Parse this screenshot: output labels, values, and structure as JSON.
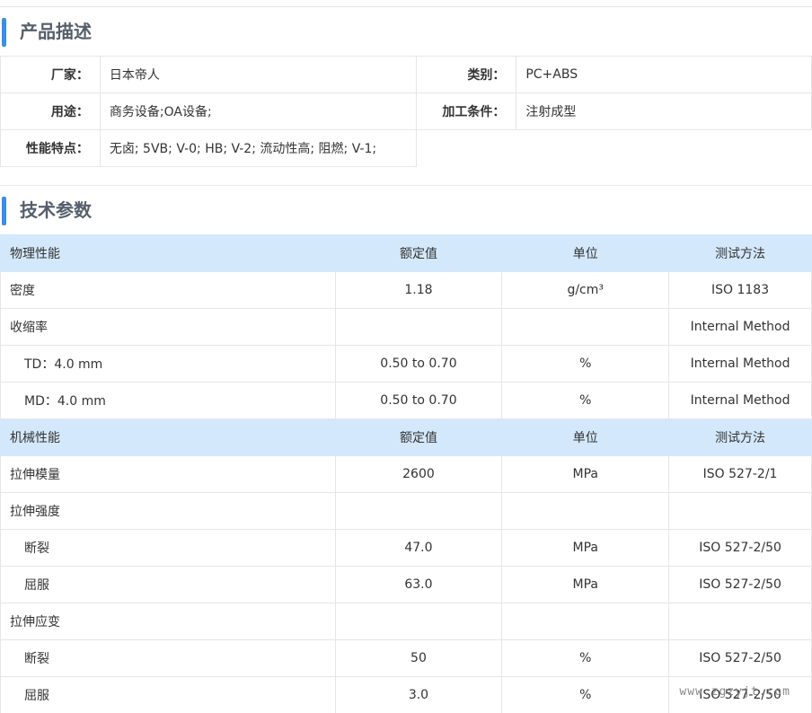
{
  "sections": {
    "description_title": "产品描述",
    "tech_title": "技术参数"
  },
  "info": {
    "manufacturer_label": "厂家：",
    "manufacturer_value": "日本帝人",
    "category_label": "类别：",
    "category_value": "PC+ABS",
    "usage_label": "用途：",
    "usage_value": "商务设备;OA设备;",
    "processing_label": "加工条件：",
    "processing_value": "注射成型",
    "features_label": "性能特点：",
    "features_value": "无卤; 5VB; V-0; HB; V-2; 流动性高; 阻燃; V-1;"
  },
  "tech_rows": [
    {
      "type": "group",
      "name": "物理性能",
      "value": "额定值",
      "unit": "单位",
      "method": "测试方法"
    },
    {
      "type": "row",
      "name": "密度",
      "value": "1.18",
      "unit": "g/cm³",
      "method": "ISO 1183"
    },
    {
      "type": "row",
      "name": "收缩率",
      "value": "",
      "unit": "",
      "method": "Internal Method"
    },
    {
      "type": "sub",
      "name": "TD：4.0 mm",
      "value": "0.50 to 0.70",
      "unit": "%",
      "method": "Internal Method"
    },
    {
      "type": "sub",
      "name": "MD：4.0 mm",
      "value": "0.50 to 0.70",
      "unit": "%",
      "method": "Internal Method"
    },
    {
      "type": "group",
      "name": "机械性能",
      "value": "额定值",
      "unit": "单位",
      "method": "测试方法"
    },
    {
      "type": "row",
      "name": "拉伸模量",
      "value": "2600",
      "unit": "MPa",
      "method": "ISO 527-2/1"
    },
    {
      "type": "row",
      "name": "拉伸强度",
      "value": "",
      "unit": "",
      "method": ""
    },
    {
      "type": "sub",
      "name": "断裂",
      "value": "47.0",
      "unit": "MPa",
      "method": "ISO 527-2/50"
    },
    {
      "type": "sub",
      "name": "屈服",
      "value": "63.0",
      "unit": "MPa",
      "method": "ISO 527-2/50"
    },
    {
      "type": "row",
      "name": "拉伸应变",
      "value": "",
      "unit": "",
      "method": ""
    },
    {
      "type": "sub",
      "name": "断裂",
      "value": "50",
      "unit": "%",
      "method": "ISO 527-2/50"
    },
    {
      "type": "sub",
      "name": "屈服",
      "value": "3.0",
      "unit": "%",
      "method": "ISO 527-2/50"
    }
  ],
  "watermark": "www.zgzyjt.com"
}
